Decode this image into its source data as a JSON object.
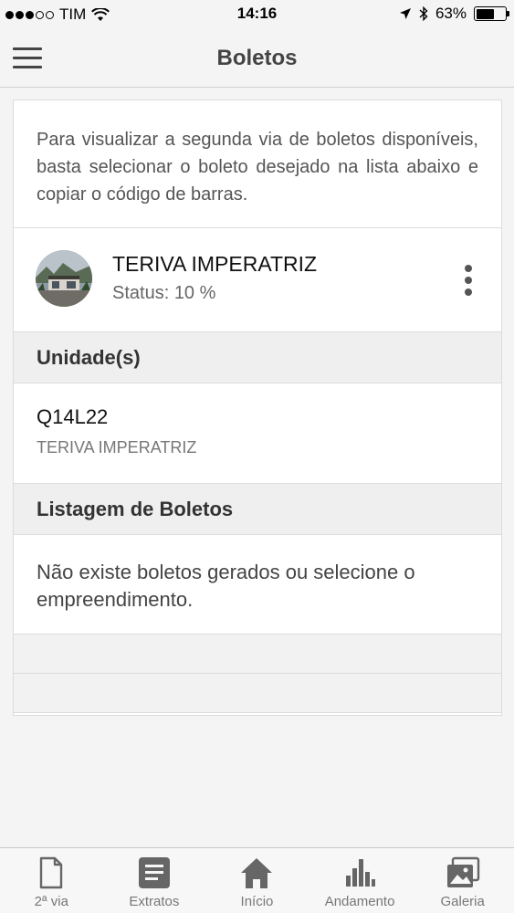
{
  "status_bar": {
    "carrier": "TIM",
    "time": "14:16",
    "battery": "63%",
    "battery_level": 0.63
  },
  "header": {
    "title": "Boletos",
    "menu_icon": "hamburger-icon"
  },
  "intro": {
    "text": "Para visualizar a segunda via de boletos disponíveis, basta selecionar o boleto desejado na lista abaixo e copiar o código de barras."
  },
  "project": {
    "name": "TERIVA IMPERATRIZ",
    "status": "Status: 10 %",
    "more_icon": "more-vertical-icon"
  },
  "units": {
    "header": "Unidade(s)",
    "items": [
      {
        "code": "Q14L22",
        "project": "TERIVA IMPERATRIZ"
      }
    ]
  },
  "boletos": {
    "header": "Listagem de Boletos",
    "empty_message": "Não existe boletos gerados ou selecione o empreendimento."
  },
  "tab_bar": {
    "items": [
      {
        "label": "2ª via",
        "icon": "document-icon"
      },
      {
        "label": "Extratos",
        "icon": "statement-icon"
      },
      {
        "label": "Início",
        "icon": "home-icon"
      },
      {
        "label": "Andamento",
        "icon": "bar-chart-icon"
      },
      {
        "label": "Galeria",
        "icon": "gallery-icon"
      }
    ],
    "icon_color": "#666666"
  }
}
